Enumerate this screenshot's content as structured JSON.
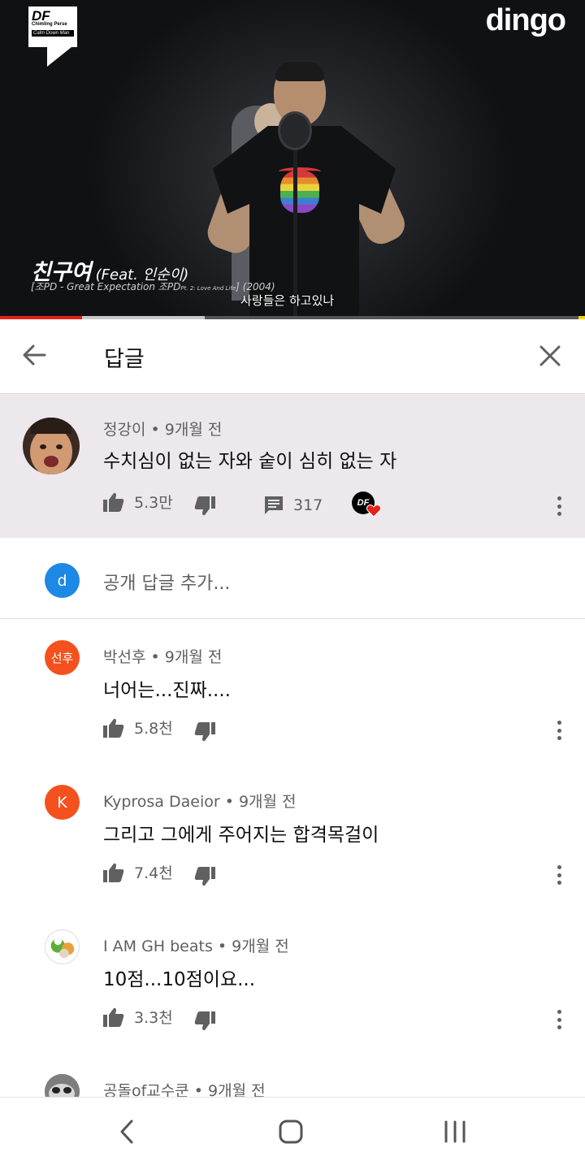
{
  "video": {
    "badge_df": "DF",
    "badge_line1": "Chimling Perse",
    "badge_line2": "Calm Down Man",
    "channel_logo": "dingo",
    "title": "친구여",
    "title_feat": "(Feat. 인순이)",
    "sub_left": "[조PD - Great Expectation 조PD",
    "sub_tiny": "Pt. 2: Love And Life",
    "sub_right": "] (2004)",
    "caption": "사랑들은 하고있나",
    "progress_played": 0.14,
    "progress_buffered": 0.35
  },
  "header": {
    "title": "답글",
    "back_icon": "arrow-left-icon",
    "close_icon": "close-icon"
  },
  "main_comment": {
    "author": "정강이",
    "time": "9개월 전",
    "text": "수치심이 없는 자와 숱이 심히 없는 자",
    "likes": "5.3만",
    "replies": "317",
    "creator_badge": "DF"
  },
  "add_reply": {
    "avatar_letter": "d",
    "placeholder": "공개 답글 추가..."
  },
  "replies": [
    {
      "author": "박선후",
      "time": "9개월 전",
      "text": "너어는...진짜....",
      "likes": "5.8천",
      "avatar_text": "선후",
      "avatar_color": "#f4511e"
    },
    {
      "author": "Kyprosa Daeior",
      "time": "9개월 전",
      "text": "그리고 그에게 주어지는 합격목걸이",
      "likes": "7.4천",
      "avatar_text": "K",
      "avatar_color": "#f4511e"
    },
    {
      "author": "I AM GH beats",
      "time": "9개월 전",
      "text": "10점...10점이요...",
      "likes": "3.3천",
      "avatar_text": "",
      "avatar_color": "#ffffff"
    },
    {
      "author": "공돌of교수쿤",
      "time": "9개월 전",
      "text": "",
      "likes": "",
      "avatar_text": "",
      "avatar_color": "#888888"
    }
  ],
  "colors": {
    "accent_red": "#e62117",
    "highlight_bg": "#ece8ec",
    "avatar_blue": "#1e88e5",
    "avatar_orange": "#f4511e"
  }
}
